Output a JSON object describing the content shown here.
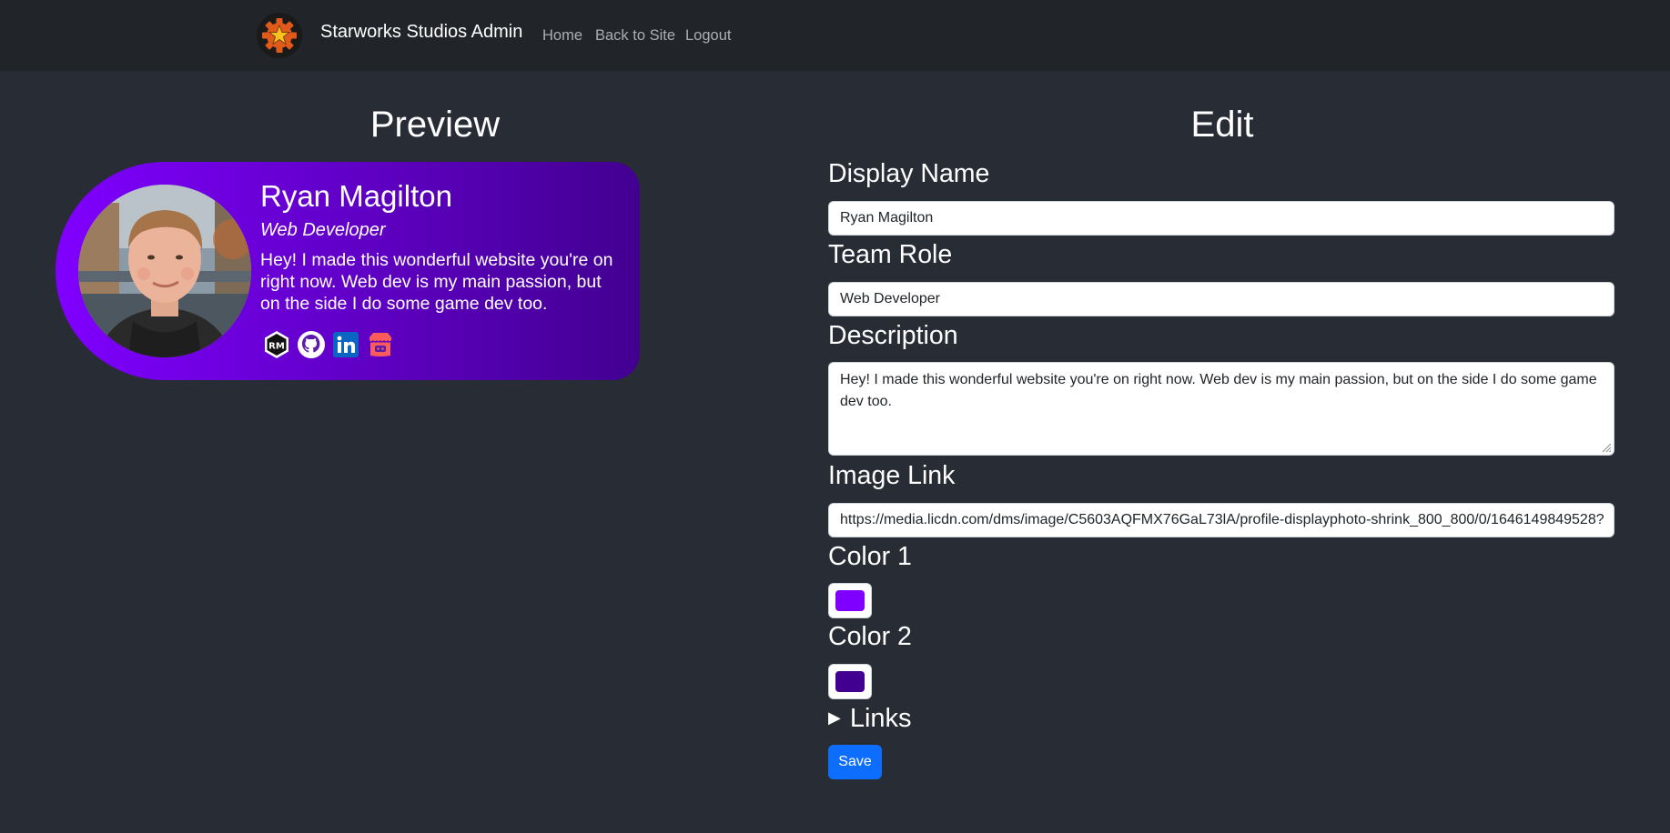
{
  "nav": {
    "brand": "Starworks Studios Admin",
    "links": [
      "Home",
      "Back to Site",
      "Logout"
    ]
  },
  "preview": {
    "heading": "Preview",
    "card": {
      "name": "Ryan Magilton",
      "role": "Web Developer",
      "description": "Hey! I made this wonderful website you're on right now. Web dev is my main passion, but on the side I do some game dev too.",
      "icons": [
        "rm-logo-icon",
        "github-icon",
        "linkedin-icon",
        "itchio-icon"
      ]
    }
  },
  "edit": {
    "heading": "Edit",
    "display_name": {
      "label": "Display Name",
      "value": "Ryan Magilton"
    },
    "team_role": {
      "label": "Team Role",
      "value": "Web Developer"
    },
    "description": {
      "label": "Description",
      "value": "Hey! I made this wonderful website you're on right now. Web dev is my main passion, but on the side I do some game dev too."
    },
    "image_link": {
      "label": "Image Link",
      "value": "https://media.licdn.com/dms/image/C5603AQFMX76GaL73lA/profile-displayphoto-shrink_800_800/0/1646149849528?"
    },
    "color1": {
      "label": "Color 1",
      "value": "#8000ff"
    },
    "color2": {
      "label": "Color 2",
      "value": "#420090"
    },
    "links_label": "Links",
    "save_label": "Save"
  },
  "colors": {
    "background": "#282c34",
    "navbar": "#212529",
    "primary_button": "#0d6efd"
  }
}
